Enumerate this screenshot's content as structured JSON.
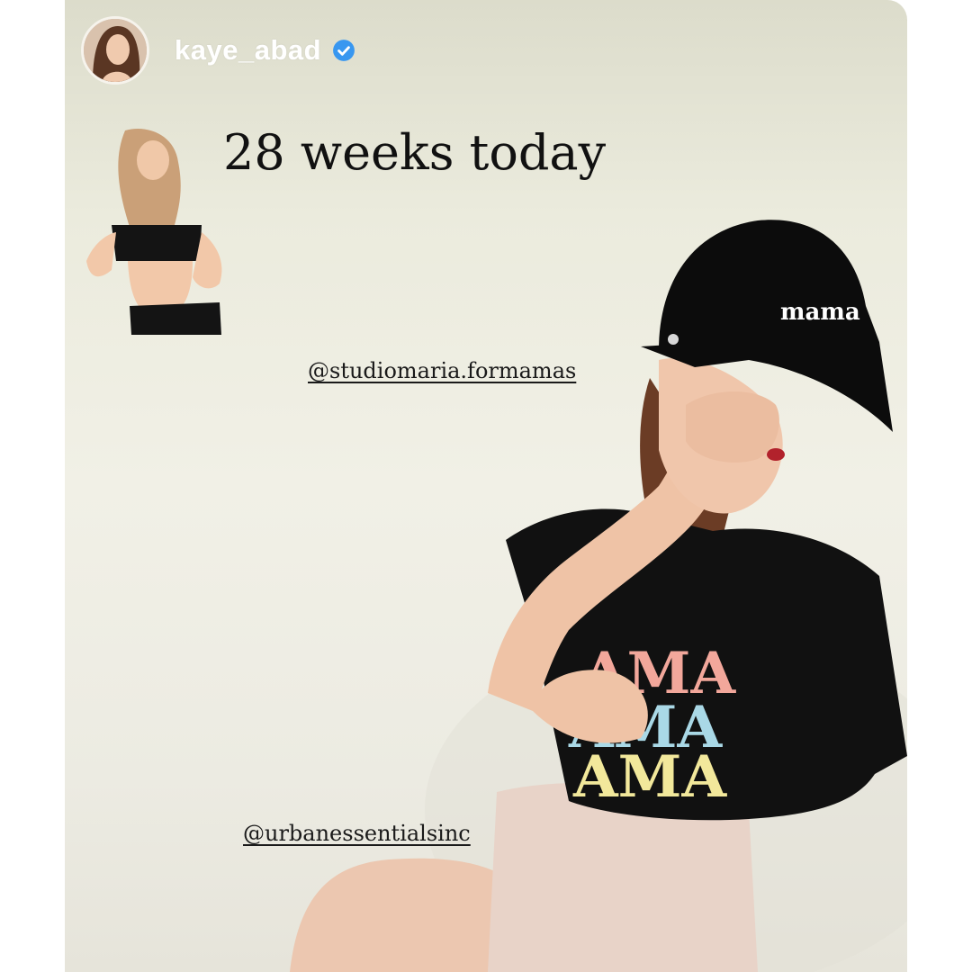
{
  "story": {
    "username": "kaye_abad",
    "verified": true,
    "caption": "28 weeks today",
    "mentions": [
      "@studiomaria.formamas",
      "@urbanessentialsinc"
    ],
    "cap_text": "mama",
    "shirt_text": [
      "AMA",
      "AMA",
      "AMA"
    ]
  },
  "icons": {
    "verified": "verified-badge-icon"
  },
  "colors": {
    "background": "#efeee4",
    "verified_blue": "#3897f0",
    "text_dark": "#111111"
  }
}
